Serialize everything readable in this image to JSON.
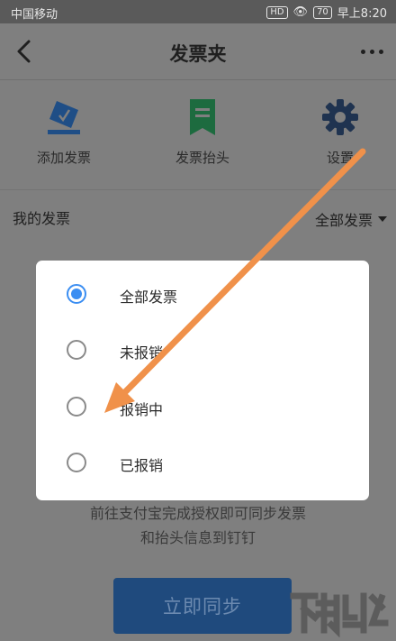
{
  "status": {
    "carrier": "中国移动",
    "battery": "70",
    "time": "早上8:20"
  },
  "nav": {
    "title": "发票夹"
  },
  "actions": [
    {
      "label": "添加发票",
      "icon": "add-invoice-icon"
    },
    {
      "label": "发票抬头",
      "icon": "invoice-header-icon"
    },
    {
      "label": "设置",
      "icon": "gear-icon"
    }
  ],
  "filter": {
    "title": "我的发票",
    "selected": "全部发票"
  },
  "dialog": {
    "options": [
      {
        "label": "全部发票",
        "checked": true
      },
      {
        "label": "未报销",
        "checked": false
      },
      {
        "label": "报销中",
        "checked": false
      },
      {
        "label": "已报销",
        "checked": false
      }
    ]
  },
  "hint": {
    "line1": "前往支付宝完成授权即可同步发票",
    "line2": "和抬头信息到钉钉"
  },
  "sync_button": "立即同步",
  "colors": {
    "accent": "#3b8ef2",
    "annotation_arrow": "#f0914a",
    "overlay": "#7f7f7f"
  }
}
